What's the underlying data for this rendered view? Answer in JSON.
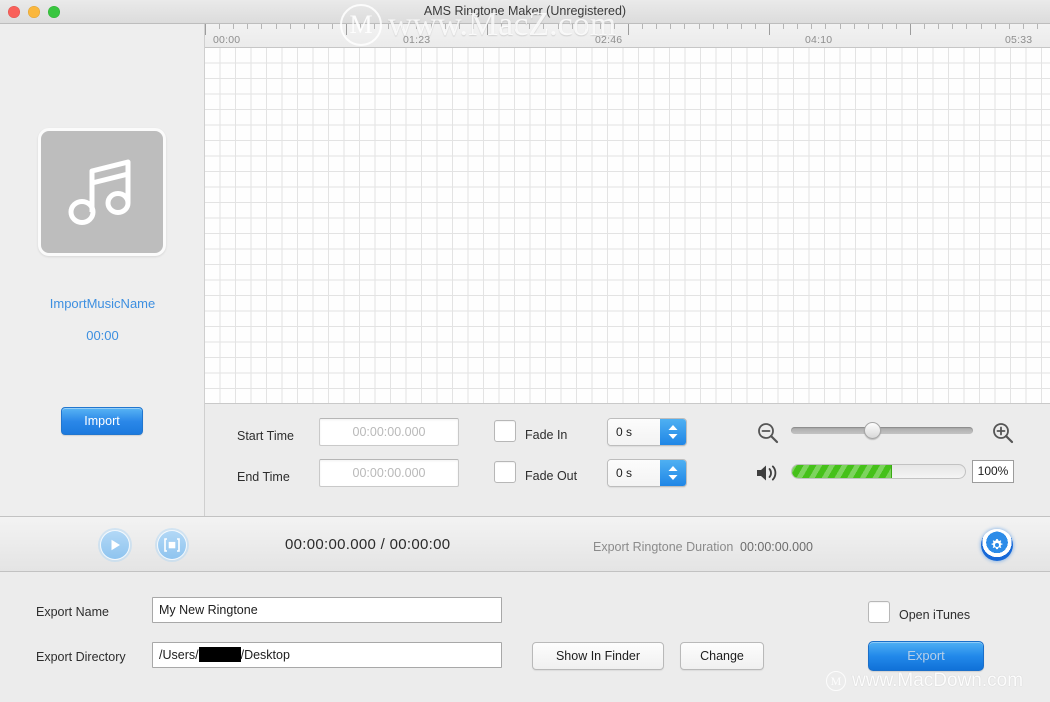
{
  "window": {
    "title": "AMS Ringtone Maker (Unregistered)",
    "traffic_lights": [
      "close",
      "minimize",
      "zoom"
    ]
  },
  "sidebar": {
    "artwork_icon": "music-note-icon",
    "music_name": "ImportMusicName",
    "music_duration": "00:00",
    "import_button": "Import"
  },
  "timeline": {
    "ruler_labels": [
      "00:00",
      "01:23",
      "02:46",
      "04:10",
      "05:33"
    ],
    "ruler_label_x": [
      8,
      198,
      390,
      600,
      800
    ]
  },
  "edit_panel": {
    "start_time_label": "Start Time",
    "start_time_value": "",
    "start_time_placeholder": "00:00:00.000",
    "end_time_label": "End Time",
    "end_time_value": "",
    "end_time_placeholder": "00:00:00.000",
    "fade_in_label": "Fade In",
    "fade_in_checked": false,
    "fade_in_seconds": "0 s",
    "fade_out_label": "Fade Out",
    "fade_out_checked": false,
    "fade_out_seconds": "0 s",
    "zoom_out_icon": "zoom-out-icon",
    "zoom_in_icon": "zoom-in-icon",
    "zoom_slider_percent": 50,
    "volume_icon": "speaker-icon",
    "volume_fill_percent": 58,
    "volume_value": "100%"
  },
  "transport": {
    "play_icon": "play-icon",
    "stop_icon": "stop-icon",
    "time_display": "00:00:00.000 / 00:00:00",
    "export_duration_label": "Export Ringtone Duration",
    "export_duration_value": "00:00:00.000",
    "settings_icon": "gear-icon"
  },
  "export_panel": {
    "name_label": "Export Name",
    "name_value": "My New Ringtone",
    "directory_label": "Export Directory",
    "directory_prefix": "/Users/",
    "directory_suffix": "/Desktop",
    "show_in_finder_button": "Show In Finder",
    "change_button": "Change",
    "open_itunes_label": "Open iTunes",
    "open_itunes_checked": false,
    "export_button": "Export"
  },
  "watermarks": {
    "top": "www.MacZ.com",
    "bottom": "www.MacDown.com",
    "logo_letter": "M"
  },
  "colors": {
    "accent_blue": "#2289ea",
    "link_blue": "#3d8fe0",
    "volume_green": "#45c119",
    "panel_gray": "#ececec"
  }
}
